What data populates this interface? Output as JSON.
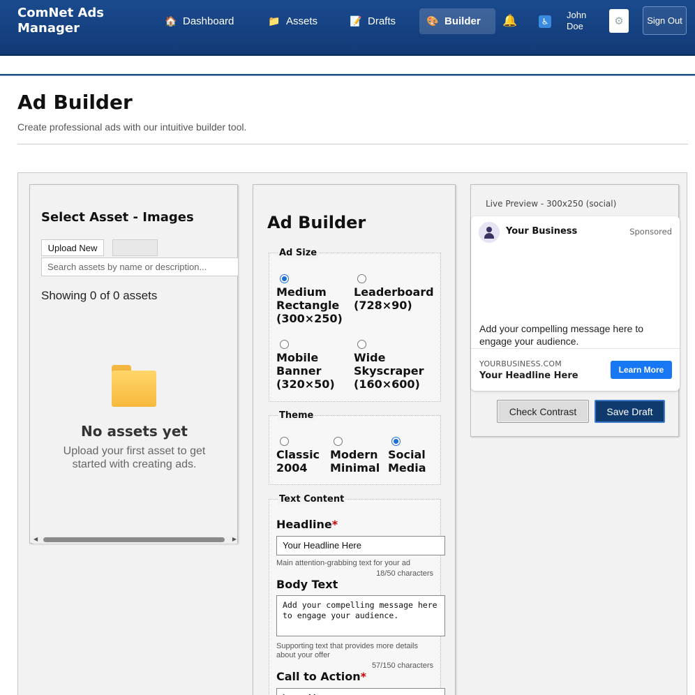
{
  "header": {
    "brand": "ComNet Ads Manager",
    "nav": [
      {
        "label": "Dashboard",
        "icon": "🏠"
      },
      {
        "label": "Assets",
        "icon": "📁"
      },
      {
        "label": "Drafts",
        "icon": "📝"
      },
      {
        "label": "Builder",
        "icon": "🎨"
      }
    ],
    "bell_icon": "🔔",
    "accessibility_icon": "♿",
    "user_name": "John Doe",
    "gear_icon": "⚙",
    "sign_out": "Sign Out"
  },
  "page": {
    "title": "Ad Builder",
    "subtitle": "Create professional ads with our intuitive builder tool."
  },
  "assets_panel": {
    "title": "Select Asset - Images",
    "upload_button": "Upload New",
    "search_placeholder": "Search assets by name or description...",
    "showing": "Showing 0 of 0 assets",
    "empty_title": "No assets yet",
    "empty_subtitle": "Upload your first asset to get started with creating ads."
  },
  "builder": {
    "title": "Ad Builder",
    "ad_size": {
      "legend": "Ad Size",
      "options": [
        {
          "label": "Medium Rectangle (300×250)",
          "selected": true
        },
        {
          "label": "Leaderboard (728×90)",
          "selected": false
        },
        {
          "label": "Mobile Banner (320×50)",
          "selected": false
        },
        {
          "label": "Wide Skyscraper (160×600)",
          "selected": false
        }
      ]
    },
    "theme": {
      "legend": "Theme",
      "options": [
        {
          "label": "Classic 2004",
          "selected": false
        },
        {
          "label": "Modern Minimal",
          "selected": false
        },
        {
          "label": "Social Media",
          "selected": true
        }
      ]
    },
    "text_content": {
      "legend": "Text Content",
      "headline_label": "Headline",
      "headline_value": "Your Headline Here",
      "headline_hint": "Main attention-grabbing text for your ad",
      "headline_count": "18/50 characters",
      "body_label": "Body Text",
      "body_value": "Add your compelling message here to engage your audience.",
      "body_hint": "Supporting text that provides more details about your offer",
      "body_count": "57/150 characters",
      "cta_label": "Call to Action",
      "cta_value": "Learn More",
      "required_mark": "*"
    }
  },
  "preview": {
    "label": "Live Preview - 300x250 (social)",
    "business": "Your Business",
    "sponsored": "Sponsored",
    "body": "Add your compelling message here to engage your audience.",
    "domain": "YOURBUSINESS.COM",
    "headline": "Your Headline Here",
    "cta": "Learn More",
    "check_contrast": "Check Contrast",
    "save_draft": "Save Draft"
  }
}
